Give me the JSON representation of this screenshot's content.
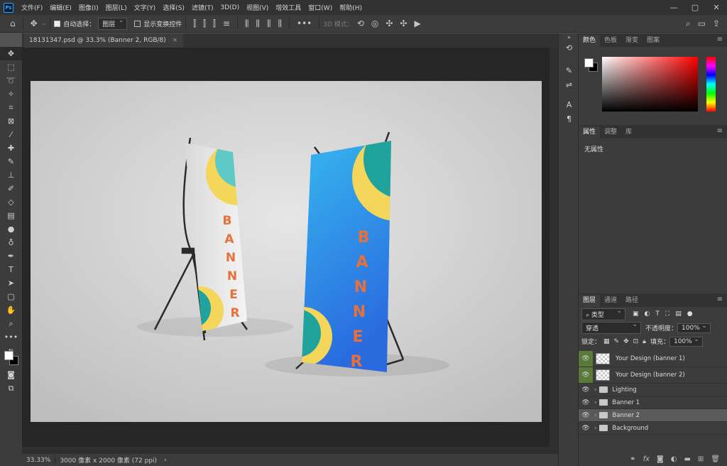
{
  "app": {
    "logo": "Ps"
  },
  "menu": [
    "文件(F)",
    "编辑(E)",
    "图像(I)",
    "图层(L)",
    "文字(Y)",
    "选择(S)",
    "滤镜(T)",
    "3D(D)",
    "视图(V)",
    "增效工具",
    "窗口(W)",
    "帮助(H)"
  ],
  "window_controls": [
    "—",
    "▢",
    "✕"
  ],
  "options": {
    "auto_select_label": "自动选择：",
    "auto_select_value": "图层",
    "show_transform_label": "显示变换控件",
    "mode_3d_label": "3D 模式："
  },
  "document_tab": {
    "title": "18131347.psd @ 33.3% (Banner 2, RGB/8)",
    "close": "×"
  },
  "status": {
    "zoom": "33.33%",
    "size": "3000 像素 x 2000 像素 (72 ppi)",
    "arrow": "›"
  },
  "banner_text": {
    "left": "BANNER",
    "right": "BANNER"
  },
  "color_panel": {
    "tabs": [
      "颜色",
      "色板",
      "渐变",
      "图案"
    ]
  },
  "properties_panel": {
    "tabs": [
      "属性",
      "调整",
      "库"
    ],
    "empty": "无属性"
  },
  "layers_panel": {
    "tabs": [
      "图层",
      "通道",
      "路径"
    ],
    "filter_kind": "类型",
    "blend_mode": "穿透",
    "opacity_label": "不透明度：",
    "opacity_value": "100%",
    "lock_label": "锁定：",
    "fill_label": "填充：",
    "fill_value": "100%",
    "layers": [
      {
        "name": "Your Design (banner 1)",
        "type": "smart"
      },
      {
        "name": "Your Design (banner 2)",
        "type": "smart"
      },
      {
        "name": "Lighting",
        "type": "group"
      },
      {
        "name": "Banner 1",
        "type": "group"
      },
      {
        "name": "Banner 2",
        "type": "group",
        "selected": true
      },
      {
        "name": "Background",
        "type": "group"
      }
    ]
  },
  "colors": {
    "accent_orange": "#e8703a",
    "banner_blue_top": "#37b6ee",
    "banner_blue_bottom": "#2a6be0",
    "yellow": "#f4d65a",
    "teal": "#1fa39c"
  }
}
